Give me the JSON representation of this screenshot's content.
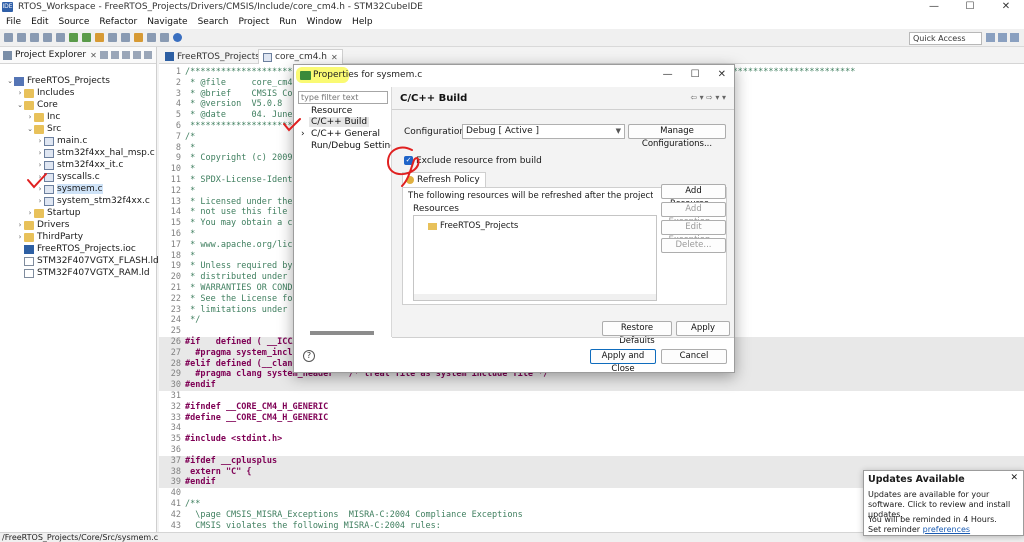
{
  "window": {
    "title": "RTOS_Workspace - FreeRTOS_Projects/Drivers/CMSIS/Include/core_cm4.h - STM32CubeIDE",
    "controls": [
      "—",
      "☐",
      "✕"
    ]
  },
  "menu": [
    "File",
    "Edit",
    "Source",
    "Refactor",
    "Navigate",
    "Search",
    "Project",
    "Run",
    "Window",
    "Help"
  ],
  "toolbar": {
    "quick_access": "Quick Access"
  },
  "explorer": {
    "tab_label": "Project Explorer",
    "tab_close": "✕",
    "items": [
      {
        "label": "FreeRTOS_Projects",
        "arrow": "⌄",
        "icon": "project-icon"
      },
      {
        "label": "Includes",
        "arrow": "›",
        "icon": "folder-icon"
      },
      {
        "label": "Core",
        "arrow": "⌄",
        "icon": "folder-icon"
      },
      {
        "label": "Inc",
        "arrow": "›",
        "icon": "folder-icon"
      },
      {
        "label": "Src",
        "arrow": "⌄",
        "icon": "folder-icon"
      },
      {
        "label": "main.c",
        "arrow": "›",
        "icon": "c-file-icon"
      },
      {
        "label": "stm32f4xx_hal_msp.c",
        "arrow": "›",
        "icon": "c-file-icon"
      },
      {
        "label": "stm32f4xx_it.c",
        "arrow": "›",
        "icon": "c-file-icon"
      },
      {
        "label": "syscalls.c",
        "arrow": "›",
        "icon": "c-file-icon"
      },
      {
        "label": "sysmem.c",
        "arrow": "›",
        "icon": "c-file-icon"
      },
      {
        "label": "system_stm32f4xx.c",
        "arrow": "›",
        "icon": "c-file-icon"
      },
      {
        "label": "Startup",
        "arrow": "›",
        "icon": "folder-icon"
      },
      {
        "label": "Drivers",
        "arrow": "›",
        "icon": "folder-icon"
      },
      {
        "label": "ThirdParty",
        "arrow": "›",
        "icon": "folder-icon"
      },
      {
        "label": "FreeRTOS_Projects.ioc",
        "arrow": "",
        "icon": "ioc-file-icon"
      },
      {
        "label": "STM32F407VGTX_FLASH.ld",
        "arrow": "",
        "icon": "file-icon"
      },
      {
        "label": "STM32F407VGTX_RAM.ld",
        "arrow": "",
        "icon": "file-icon"
      }
    ]
  },
  "editor_tabs": [
    {
      "label": "FreeRTOS_Projects.ioc",
      "close": ""
    },
    {
      "label": "core_cm4.h",
      "close": "✕"
    }
  ],
  "code_lines": [
    {
      "n": "1",
      "t": "/**********************************************************************************************************************************"
    },
    {
      "n": "2",
      "t": " * @file     core_cm4.h"
    },
    {
      "n": "3",
      "t": " * @brief    CMSIS Cortex-M4 Core Peripheral Access Layer Header File"
    },
    {
      "n": "4",
      "t": " * @version  V5.0.8"
    },
    {
      "n": "5",
      "t": " * @date     04. June 2018"
    },
    {
      "n": "6",
      "t": " ******************************************************************************/"
    },
    {
      "n": "7",
      "t": "/*"
    },
    {
      "n": "8",
      "t": " *"
    },
    {
      "n": "9",
      "t": " * Copyright (c) 2009-2018 Arm Limited. All rights reserved."
    },
    {
      "n": "10",
      "t": " *"
    },
    {
      "n": "11",
      "t": " * SPDX-License-Identifier: Apache-2.0"
    },
    {
      "n": "12",
      "t": " *"
    },
    {
      "n": "13",
      "t": " * Licensed under the Apache License, Version 2.0 (the License); you may"
    },
    {
      "n": "14",
      "t": " * not use this file except in compliance with the License."
    },
    {
      "n": "15",
      "t": " * You may obtain a copy of the License at"
    },
    {
      "n": "16",
      "t": " *"
    },
    {
      "n": "17",
      "t": " * www.apache.org/licenses/LICENSE-2.0"
    },
    {
      "n": "18",
      "t": " *"
    },
    {
      "n": "19",
      "t": " * Unless required by applicable law or agreed to in writing, software"
    },
    {
      "n": "20",
      "t": " * distributed under the License is distributed on an AS IS BASIS, WITHOUT"
    },
    {
      "n": "21",
      "t": " * WARRANTIES OR CONDITIONS OF ANY KIND, either express or implied."
    },
    {
      "n": "22",
      "t": " * See the License for the specific language governing permissions and"
    },
    {
      "n": "23",
      "t": " * limitations under the License."
    },
    {
      "n": "24",
      "t": " */"
    },
    {
      "n": "25",
      "t": ""
    },
    {
      "n": "26",
      "t": "#if   defined ( __ICCARM__ )"
    },
    {
      "n": "27",
      "t": "  #pragma system_include         /* treat file as system include file for MISRA check */"
    },
    {
      "n": "28",
      "t": "#elif defined (__clang__)"
    },
    {
      "n": "29",
      "t": "  #pragma clang system_header   /* treat file as system include file */"
    },
    {
      "n": "30",
      "t": "#endif"
    },
    {
      "n": "31",
      "t": ""
    },
    {
      "n": "32",
      "t": "#ifndef __CORE_CM4_H_GENERIC"
    },
    {
      "n": "33",
      "t": "#define __CORE_CM4_H_GENERIC"
    },
    {
      "n": "34",
      "t": ""
    },
    {
      "n": "35",
      "t": "#include <stdint.h>"
    },
    {
      "n": "36",
      "t": ""
    },
    {
      "n": "37",
      "t": "#ifdef __cplusplus"
    },
    {
      "n": "38",
      "t": " extern \"C\" {"
    },
    {
      "n": "39",
      "t": "#endif"
    },
    {
      "n": "40",
      "t": ""
    },
    {
      "n": "41",
      "t": "/**"
    },
    {
      "n": "42",
      "t": "  \\page CMSIS_MISRA_Exceptions  MISRA-C:2004 Compliance Exceptions"
    },
    {
      "n": "43",
      "t": "  CMSIS violates the following MISRA-C:2004 rules:"
    }
  ],
  "dialog": {
    "title": "Properties for sysmem.c",
    "controls": [
      "—",
      "☐",
      "✕"
    ],
    "filter_placeholder": "type filter text",
    "nav": [
      {
        "label": "Resource",
        "arrow": ""
      },
      {
        "label": "C/C++ Build",
        "arrow": ""
      },
      {
        "label": "C/C++ General",
        "arrow": "›"
      },
      {
        "label": "Run/Debug Settings",
        "arrow": ""
      }
    ],
    "page_title": "C/C++ Build",
    "history_nav": "⇦ ▾ ⇨ ▾ ▾",
    "configuration_label": "Configuration:",
    "configuration_value": "Debug  [ Active ]",
    "manage_button": "Manage Configurations...",
    "exclude_label": "Exclude resource from build",
    "exclude_checked": true,
    "tab_label": "Refresh Policy",
    "refresh_description": "The following resources will be refreshed after the project is built (o",
    "resources_label": "Resources",
    "resources": [
      "FreeRTOS_Projects"
    ],
    "buttons": {
      "add_resource": "Add Resource...",
      "add_exception": "Add Exception...",
      "edit_exception": "Edit Exception...",
      "delete": "Delete...",
      "restore_defaults": "Restore Defaults",
      "apply": "Apply",
      "apply_close": "Apply and Close",
      "cancel": "Cancel"
    }
  },
  "status_bar": "/FreeRTOS_Projects/Core/Src/sysmem.c",
  "updates": {
    "title": "Updates Available",
    "close": "✕",
    "body": "Updates are available for your software. Click to review and install updates.",
    "reminder": "You will be reminded in 4 Hours.",
    "set_reminder": "Set reminder",
    "preferences_link": "preferences"
  },
  "colors": {
    "annotation_red": "#e02020",
    "highlight_yellow": "#f6f600",
    "accent_blue": "#1f64c8"
  }
}
